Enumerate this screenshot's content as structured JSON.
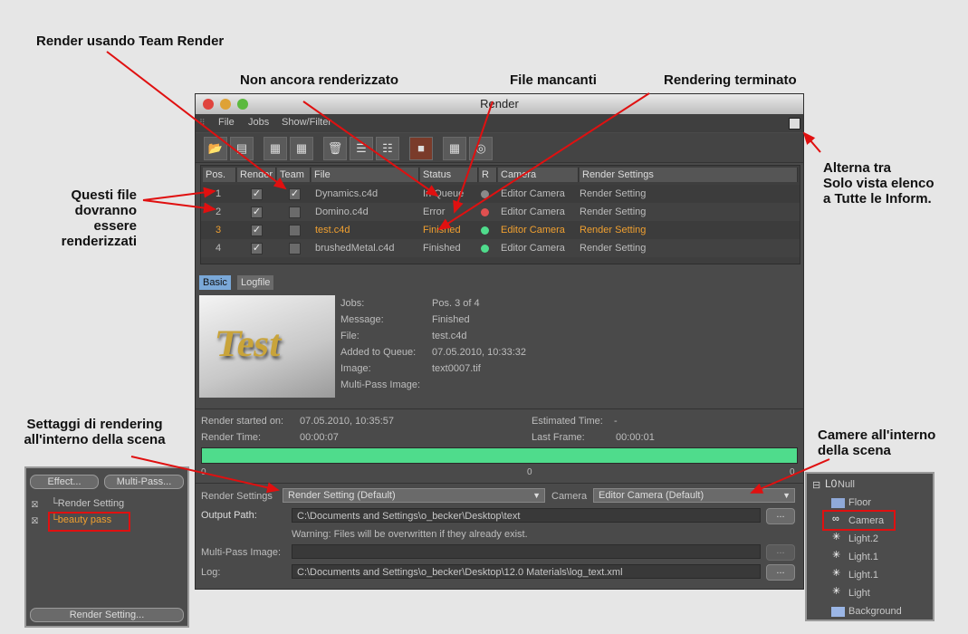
{
  "callouts": {
    "team_render": "Render usando Team Render",
    "not_rendered": "Non ancora renderizzato",
    "missing": "File mancanti",
    "finished": "Rendering terminato",
    "toggle_l1": "Alterna tra",
    "toggle_l2": "Solo vista elenco",
    "toggle_l3": "a Tutte le Inform.",
    "files_l1": "Questi file",
    "files_l2": "dovranno",
    "files_l3": "essere",
    "files_l4": "renderizzati",
    "scene_settings_l1": "Settaggi di rendering",
    "scene_settings_l2": "all'interno della scena",
    "cameras_l1": "Camere all'interno",
    "cameras_l2": "della scena"
  },
  "window": {
    "title": "Render",
    "menu": [
      "File",
      "Jobs",
      "Show/Filter"
    ]
  },
  "columns": [
    "Pos.",
    "Render",
    "Team",
    "File",
    "Status",
    "R",
    "Camera",
    "Render Settings"
  ],
  "jobs": [
    {
      "pos": "1",
      "render": true,
      "team": true,
      "file": "Dynamics.c4d",
      "status": "In Queue",
      "dot": "#8a8a8a",
      "camera": "Editor Camera",
      "settings": "Render Setting",
      "highlight": false
    },
    {
      "pos": "2",
      "render": true,
      "team": false,
      "file": "Domino.c4d",
      "status": "Error",
      "dot": "#e05050",
      "camera": "Editor Camera",
      "settings": "Render Setting",
      "highlight": false
    },
    {
      "pos": "3",
      "render": true,
      "team": false,
      "file": "test.c4d",
      "status": "Finished",
      "dot": "#4fdc8c",
      "camera": "Editor Camera",
      "settings": "Render Setting",
      "highlight": true
    },
    {
      "pos": "4",
      "render": true,
      "team": false,
      "file": "brushedMetal.c4d",
      "status": "Finished",
      "dot": "#4fdc8c",
      "camera": "Editor Camera",
      "settings": "Render Setting",
      "highlight": false
    }
  ],
  "tabs": {
    "basic": "Basic",
    "logfile": "Logfile"
  },
  "preview_text": "Test",
  "info": {
    "jobs_label": "Jobs:",
    "jobs_value": "Pos. 3 of 4",
    "message_label": "Message:",
    "message_value": "Finished",
    "file_label": "File:",
    "file_value": "test.c4d",
    "added_label": "Added to Queue:",
    "added_value": "07.05.2010, 10:33:32",
    "image_label": "Image:",
    "image_value": "text0007.tif",
    "multipass_label": "Multi-Pass Image:"
  },
  "stats": {
    "started_label": "Render started on:",
    "started_value": "07.05.2010, 10:35:57",
    "rtime_label": "Render Time:",
    "rtime_value": "00:00:07",
    "est_label": "Estimated Time:",
    "est_value": "-",
    "last_label": "Last Frame:",
    "last_value": "00:00:01",
    "progress_fraction": 1.0,
    "progress_ticks": [
      "0",
      "0",
      "0"
    ]
  },
  "settings": {
    "render_settings_label": "Render Settings",
    "render_settings_value": "Render Setting (Default)",
    "camera_label": "Camera",
    "camera_value": "Editor Camera (Default)",
    "output_label": "Output Path:",
    "output_value": "C:\\Documents and Settings\\o_becker\\Desktop\\text",
    "warning": "Warning: Files will be overwritten if they already exist.",
    "multipass_label": "Multi-Pass Image:",
    "log_label": "Log:",
    "log_value": "C:\\Documents and Settings\\o_becker\\Desktop\\12.0 Materials\\log_text.xml",
    "browse": "..."
  },
  "left_panel": {
    "effect_button": "Effect...",
    "multipass_button": "Multi-Pass...",
    "items": [
      "Render Setting",
      "beauty pass"
    ],
    "render_setting_button": "Render Setting..."
  },
  "right_panel": {
    "items": [
      "Null",
      "Floor",
      "Camera",
      "Light.2",
      "Light.1",
      "Light.1",
      "Light",
      "Background"
    ]
  },
  "colors": {
    "highlight": "#f0a030",
    "progress": "#4fdc8c",
    "annotation": "#e01010"
  }
}
